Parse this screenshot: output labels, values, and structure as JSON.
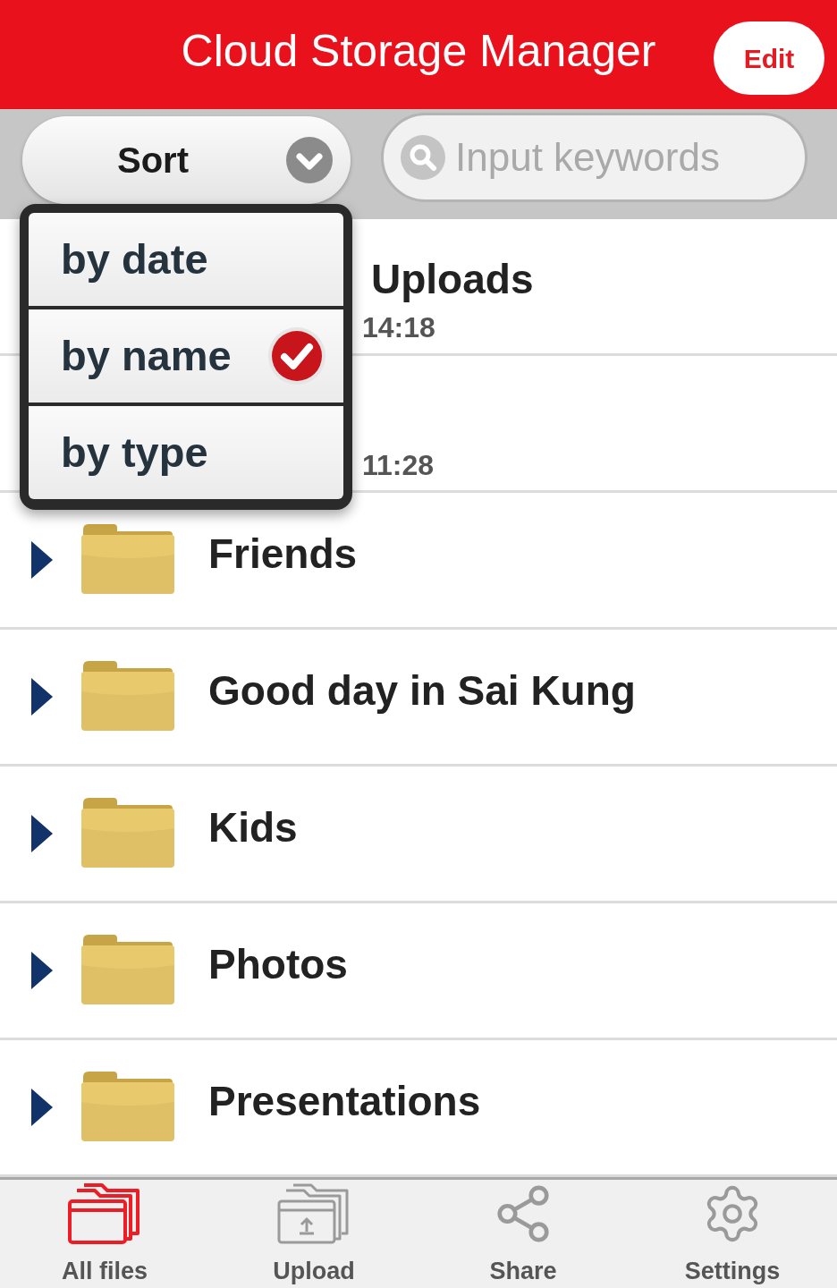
{
  "header": {
    "title": "Cloud Storage Manager",
    "edit_button": "Edit"
  },
  "toolbar": {
    "sort_button": "Sort",
    "search": {
      "placeholder": "Input keywords"
    }
  },
  "sort_menu": {
    "open": true,
    "items": [
      {
        "label": "by date",
        "selected": false
      },
      {
        "label": "by name",
        "selected": true
      },
      {
        "label": "by type",
        "selected": false
      }
    ]
  },
  "files": [
    {
      "kind": "covered",
      "title": "Uploads",
      "subtitle": "14:18"
    },
    {
      "kind": "covered",
      "subtitle": "11:28"
    },
    {
      "kind": "folder",
      "title": "Friends"
    },
    {
      "kind": "folder",
      "title": "Good day in Sai Kung"
    },
    {
      "kind": "folder",
      "title": "Kids"
    },
    {
      "kind": "folder",
      "title": "Photos"
    },
    {
      "kind": "folder",
      "title": "Presentations"
    }
  ],
  "tab_bar": [
    {
      "label": "All files",
      "selected": true
    },
    {
      "label": "Upload",
      "selected": false
    },
    {
      "label": "Share",
      "selected": false
    },
    {
      "label": "Settings",
      "selected": false
    }
  ]
}
